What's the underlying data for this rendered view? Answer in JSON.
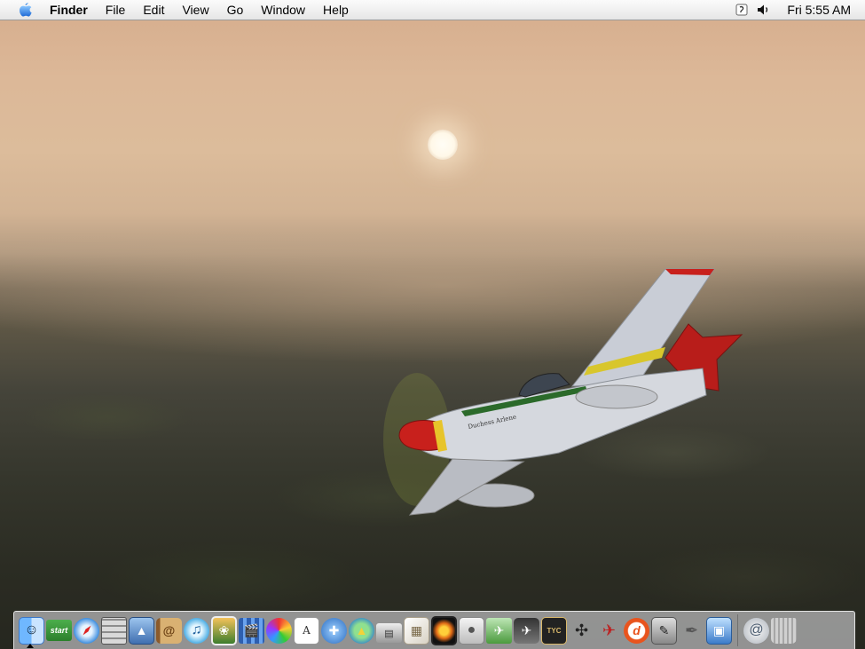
{
  "menubar": {
    "app_name": "Finder",
    "menus": [
      "File",
      "Edit",
      "View",
      "Go",
      "Window",
      "Help"
    ],
    "clock": "Fri 5:55 AM"
  },
  "desktop": {
    "aircraft_nose_art": "Duchess Arlene"
  },
  "dock": {
    "start_badge": "start",
    "items": [
      "finder-icon",
      "start-app-icon",
      "safari-icon",
      "calculator-icon",
      "preview-icon",
      "address-book-icon",
      "itunes-icon",
      "iphoto-icon",
      "imovie-icon",
      "colorsync-icon",
      "textedit-icon",
      "network-utility-icon",
      "internet-connect-icon",
      "printer-icon",
      "package-icon",
      "photo-app-icon",
      "apple-logo-icon",
      "x-plane-icon",
      "jet-aircraft-icon",
      "tycoon-icon",
      "helicopter-icon",
      "propeller-plane-icon",
      "dreamweaver-icon",
      "script-editor-icon",
      "stickies-icon",
      "image-capture-icon",
      "mail-icon",
      "trash-icon"
    ]
  }
}
